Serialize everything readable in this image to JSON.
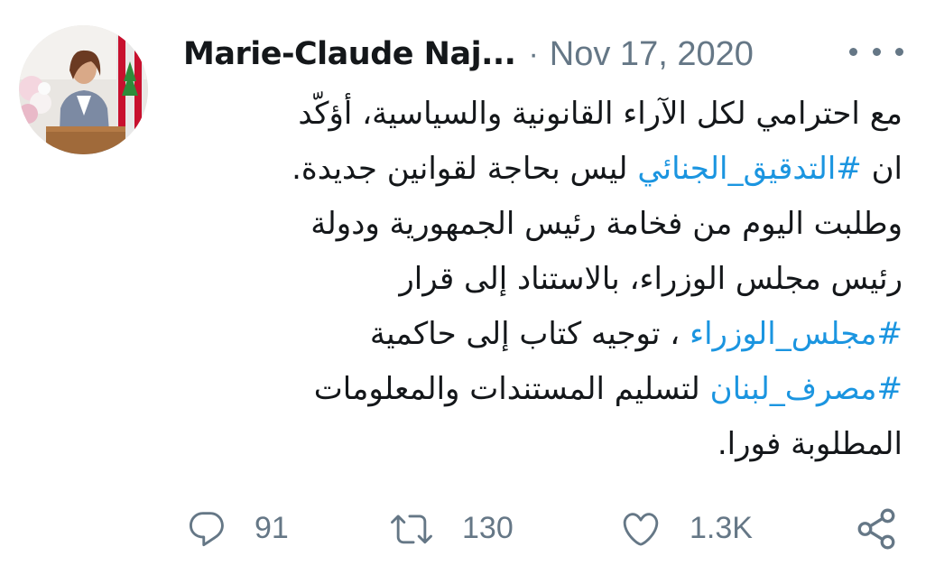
{
  "tweet": {
    "author_name": "Marie-Claude Naj...",
    "separator": "·",
    "date": "Nov 17, 2020",
    "body_lines": [
      [
        {
          "text": "مع احترامي لكل الآراء القانونية والسياسية، أؤكّد",
          "tag": false
        }
      ],
      [
        {
          "text": "ان ",
          "tag": false
        },
        {
          "text": "#التدقيق_الجنائي",
          "tag": true
        },
        {
          "text": " ليس بحاجة لقوانين جديدة.",
          "tag": false
        }
      ],
      [
        {
          "text": "وطلبت اليوم من فخامة رئيس الجمهورية ودولة",
          "tag": false
        }
      ],
      [
        {
          "text": "رئيس مجلس الوزراء، بالاستناد إلى قرار",
          "tag": false
        }
      ],
      [
        {
          "text": "#مجلس_الوزراء",
          "tag": true
        },
        {
          "text": " ، توجيه كتاب إلى حاكمية",
          "tag": false
        }
      ],
      [
        {
          "text": "#مصرف_لبنان",
          "tag": true
        },
        {
          "text": " لتسليم المستندات والمعلومات",
          "tag": false
        }
      ],
      [
        {
          "text": "المطلوبة فورا.",
          "tag": false
        }
      ]
    ]
  },
  "actions": {
    "reply_count": "91",
    "retweet_count": "130",
    "like_count": "1.3K"
  },
  "icons": {
    "more": "more-options-icon",
    "reply": "reply-icon",
    "retweet": "retweet-icon",
    "like": "heart-icon",
    "share": "share-icon"
  },
  "colors": {
    "text": "#14171a",
    "muted": "#657786",
    "link": "#1b95e0"
  }
}
